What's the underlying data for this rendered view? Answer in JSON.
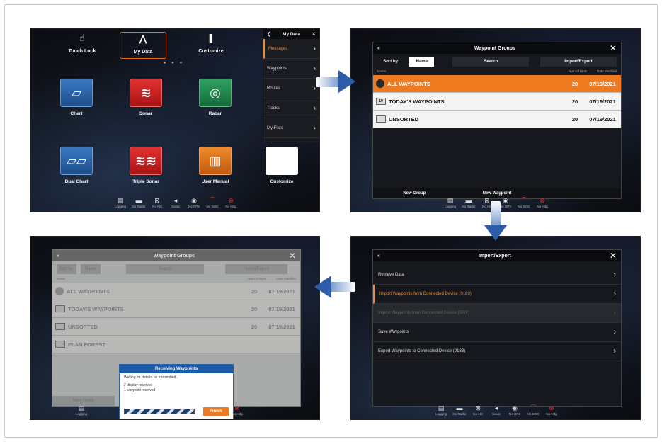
{
  "screen1": {
    "top_items": [
      "Touch Lock",
      "My Data",
      "Customize"
    ],
    "tiles": [
      "Chart",
      "Sonar",
      "Radar",
      "Dual Chart",
      "Triple Sonar",
      "User Manual",
      "Customize"
    ],
    "side_title": "My Data",
    "side_items": [
      "Messages",
      "Waypoints",
      "Routes",
      "Tracks",
      "My Files"
    ]
  },
  "status_items": [
    "Logging",
    "No Radar",
    "No AIS",
    "Sonar",
    "No GPS",
    "No SOG",
    "No Hdg"
  ],
  "waypoint_groups": {
    "title": "Waypoint Groups",
    "sort_by": "Sort by:",
    "sort_name": "Name",
    "search": "Search",
    "import_export": "Import/Export",
    "col_name": "Name",
    "col_num": "Num of Wpts",
    "col_date": "Date Modified",
    "rows": [
      {
        "name": "ALL WAYPOINTS",
        "num": "20",
        "date": "07/19/2021"
      },
      {
        "name": "TODAY'S WAYPOINTS",
        "num": "20",
        "date": "07/19/2021"
      },
      {
        "name": "UNSORTED",
        "num": "20",
        "date": "07/19/2021"
      }
    ],
    "new_group": "New Group",
    "new_waypoint": "New Waypoint"
  },
  "import_export": {
    "title": "Import/Export",
    "items": [
      "Retrieve Data",
      "Import Waypoints from Connected Device (0183)",
      "Import Waypoints from Connected Device (GRF)",
      "Save Waypoints",
      "Export Waypoints to Connected Device (0183)"
    ]
  },
  "receiving": {
    "title": "Receiving Waypoints",
    "line1": "Waiting for data to be transmitted...",
    "line2": "2 display received",
    "line3": "1 waypoint received",
    "finish": "Finish",
    "extra_row": "PLAN FOREST"
  }
}
